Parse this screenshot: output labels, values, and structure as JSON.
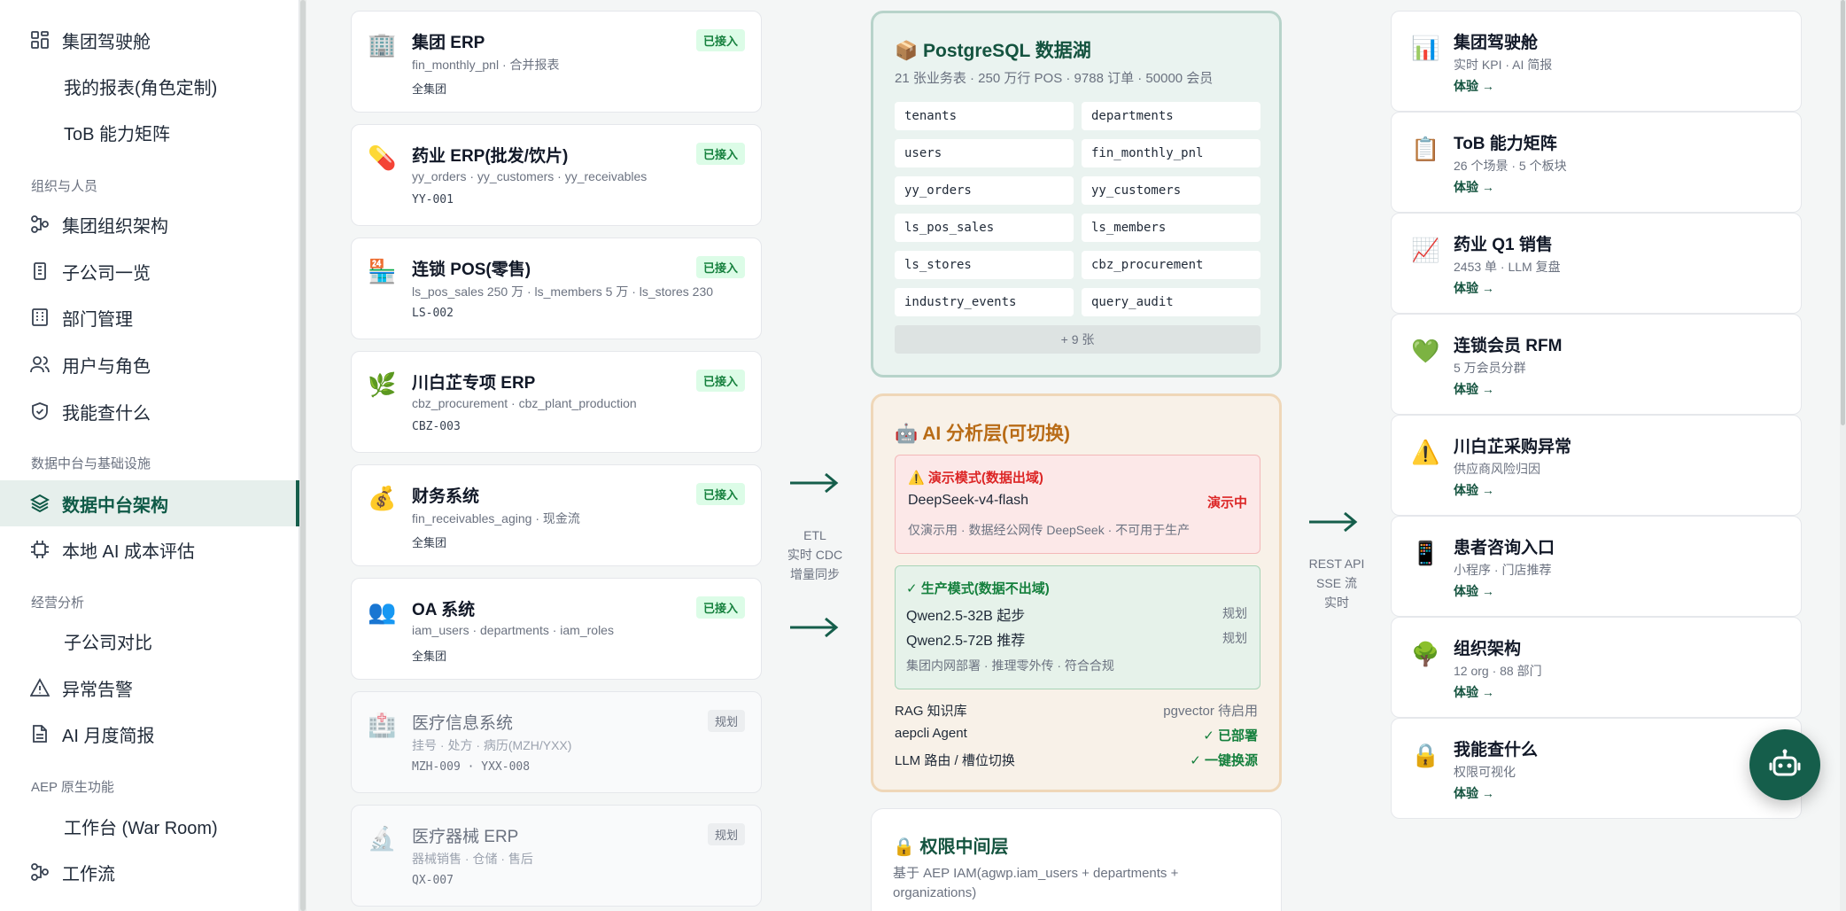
{
  "sidebar": {
    "items": [
      {
        "label": "集团驾驶舱",
        "icon": "dashboard-icon"
      },
      {
        "label": "我的报表(角色定制)"
      },
      {
        "label": "ToB 能力矩阵"
      },
      {
        "label": "集团组织架构",
        "icon": "org-icon"
      },
      {
        "label": "子公司一览",
        "icon": "building-icon"
      },
      {
        "label": "部门管理",
        "icon": "grid-icon"
      },
      {
        "label": "用户与角色",
        "icon": "users-icon"
      },
      {
        "label": "我能查什么",
        "icon": "shield-icon"
      },
      {
        "label": "数据中台架构",
        "icon": "layers-icon"
      },
      {
        "label": "本地 AI 成本评估",
        "icon": "chip-icon"
      },
      {
        "label": "子公司对比"
      },
      {
        "label": "异常告警",
        "icon": "warning-icon"
      },
      {
        "label": "AI 月度简报",
        "icon": "document-icon"
      },
      {
        "label": "工作台 (War Room)"
      },
      {
        "label": "工作流",
        "icon": "workflow-icon"
      }
    ],
    "sections": [
      "组织与人员",
      "数据中台与基础设施",
      "经营分析",
      "AEP 原生功能"
    ]
  },
  "sources": [
    {
      "title": "集团 ERP",
      "sub": "fin_monthly_pnl · 合并报表",
      "foot": "全集团",
      "badge": "已接入"
    },
    {
      "title": "药业 ERP(批发/饮片)",
      "sub": "yy_orders · yy_customers · yy_receivables",
      "foot": "YY-001",
      "badge": "已接入"
    },
    {
      "title": "连锁 POS(零售)",
      "sub": "ls_pos_sales 250 万 · ls_members 5 万 · ls_stores 230",
      "foot": "LS-002",
      "badge": "已接入"
    },
    {
      "title": "川白芷专项 ERP",
      "sub": "cbz_procurement · cbz_plant_production",
      "foot": "CBZ-003",
      "badge": "已接入"
    },
    {
      "title": "财务系统",
      "sub": "fin_receivables_aging · 现金流",
      "foot": "全集团",
      "badge": "已接入"
    },
    {
      "title": "OA 系统",
      "sub": "iam_users · departments · iam_roles",
      "foot": "全集团",
      "badge": "已接入"
    },
    {
      "title": "医疗信息系统",
      "sub": "挂号 · 处方 · 病历(MZH/YXX)",
      "foot": "MZH-009 · YXX-008",
      "badge": "规划"
    },
    {
      "title": "医疗器械 ERP",
      "sub": "器械销售 · 仓储 · 售后",
      "foot": "QX-007",
      "badge": "规划"
    }
  ],
  "flow": {
    "left_label": [
      "ETL",
      "实时 CDC",
      "增量同步"
    ],
    "right_label": [
      "REST API",
      "SSE 流",
      "实时"
    ]
  },
  "pg": {
    "title": "PostgreSQL 数据湖",
    "sub": "21 张业务表 · 250 万行 POS · 9788 订单 · 50000 会员",
    "tables": [
      "tenants",
      "departments",
      "users",
      "fin_monthly_pnl",
      "yy_orders",
      "yy_customers",
      "ls_pos_sales",
      "ls_members",
      "ls_stores",
      "cbz_procurement",
      "industry_events",
      "query_audit"
    ],
    "more": "+ 9 张"
  },
  "ai": {
    "title": "AI 分析层(可切换)",
    "demo": {
      "title": "演示模式(数据出域)",
      "model": "DeepSeek-v4-flash",
      "status": "演示中",
      "note": "仅演示用 · 数据经公网传 DeepSeek · 不可用于生产"
    },
    "prod": {
      "title": "✓ 生产模式(数据不出域)",
      "m1": "Qwen2.5-32B 起步",
      "m1_status": "规划",
      "m2": "Qwen2.5-72B 推荐",
      "m2_status": "规划",
      "note": "集团内网部署 · 推理零外传 · 符合合规"
    },
    "rows": [
      {
        "k": "RAG 知识库",
        "v": "pgvector 待启用"
      },
      {
        "k": "aepcli Agent",
        "v": "✓ 已部署"
      },
      {
        "k": "LLM 路由 / 槽位切换",
        "v": "✓ 一键换源"
      }
    ]
  },
  "perm": {
    "title": "权限中间层",
    "desc_1": "基于 AEP IAM(agwp.iam_users + departments +",
    "desc_2": "organizations)"
  },
  "outputs": [
    {
      "title": "集团驾驶舱",
      "sub": "实时 KPI · AI 简报",
      "link": "体验 →"
    },
    {
      "title": "ToB 能力矩阵",
      "sub": "26 个场景 · 5 个板块",
      "link": "体验 →"
    },
    {
      "title": "药业 Q1 销售",
      "sub": "2453 单 · LLM 复盘",
      "link": "体验 →"
    },
    {
      "title": "连锁会员 RFM",
      "sub": "5 万会员分群",
      "link": "体验 →"
    },
    {
      "title": "川白芷采购异常",
      "sub": "供应商风险归因",
      "link": "体验 →"
    },
    {
      "title": "患者咨询入口",
      "sub": "小程序 · 门店推荐",
      "link": "体验 →"
    },
    {
      "title": "组织架构",
      "sub": "12 org · 88 部门",
      "link": "体验 →"
    },
    {
      "title": "我能查什么",
      "sub": "权限可视化",
      "link": "体验 →"
    }
  ],
  "colors": {
    "brand": "#155e4b",
    "accent_orange": "#b86b16",
    "danger": "#dc2626",
    "success": "#15803d"
  }
}
